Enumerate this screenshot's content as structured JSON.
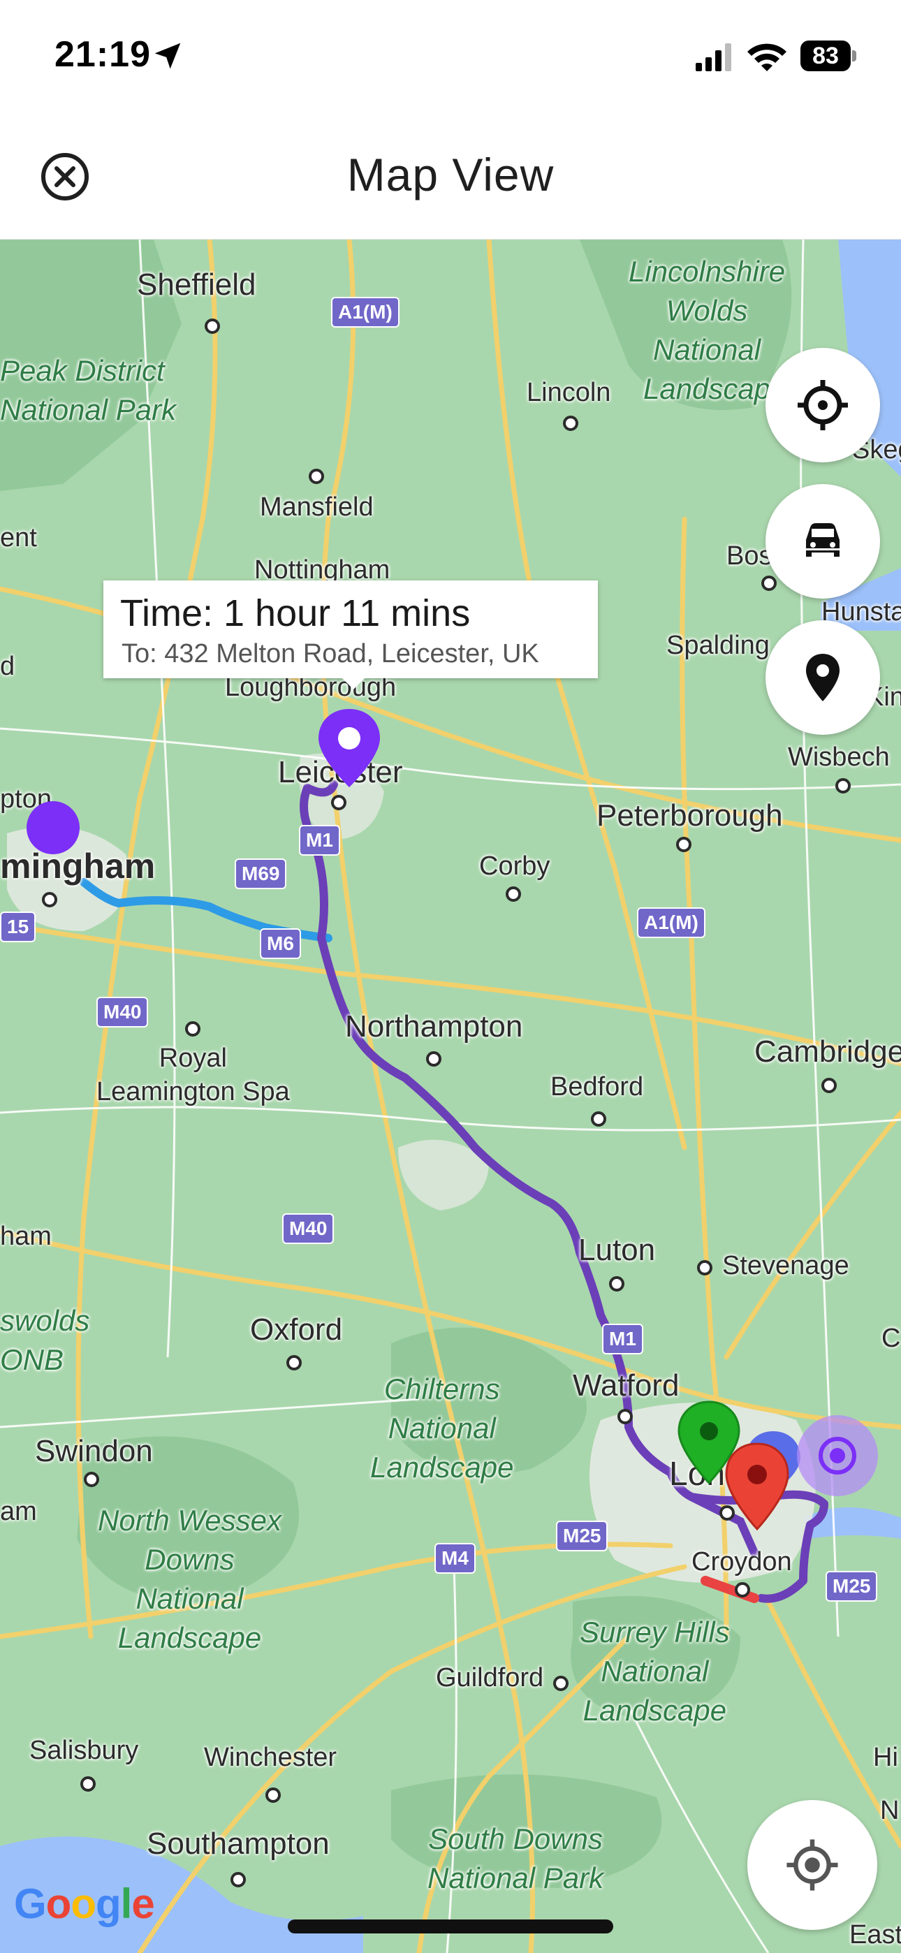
{
  "status_bar": {
    "time": "21:19",
    "battery": "83"
  },
  "header": {
    "title": "Map View"
  },
  "info_window": {
    "title": "Time: 1 hour 11 mins",
    "subtitle": "To: 432 Melton Road, Leicester, UK"
  },
  "map_labels": {
    "sheffield": "Sheffield",
    "peak": "Peak District\nNational Park",
    "lincolnshire": "Lincolnshire\nWolds\nNational\nLandscap",
    "lincoln": "Lincoln",
    "mansfield": "Mansfield",
    "nottingham": "Nottingham",
    "bos": "Bos",
    "hunsta": "Hunsta",
    "spalding": "Spalding",
    "loughborough": "Loughborough",
    "leicester": "Leicester",
    "wisbech": "Wisbech",
    "peterborough": "Peterborough",
    "birmingham": "mingham",
    "corby": "Corby",
    "northampton": "Northampton",
    "royal": "Royal\nLeamington Spa",
    "cambridge": "Cambridge",
    "bedford": "Bedford",
    "luton": "Luton",
    "stevenage": "Stevenage",
    "ham": "ham",
    "cotswolds": "swolds\nONB",
    "oxford": "Oxford",
    "chilterns": "Chilterns\nNational\nLandscape",
    "watford": "Watford",
    "swindon": "Swindon",
    "am": "am",
    "north_wessex": "North Wessex\nDowns\nNational\nLandscape",
    "london": "Lon",
    "croydon": "Croydon",
    "surrey": "Surrey Hills\nNational\nLandscape",
    "guildford": "Guildford",
    "salisbury": "Salisbury",
    "winchester": "Winchester",
    "southampton": "Southampton",
    "south_downs": "South Downs\nNational Park",
    "eastbo": "Eastbo",
    "ent": "ent",
    "d": "d",
    "pton": "pton",
    "skeg": "Skeg",
    "kin": "Kin",
    "c": "C",
    "hi": "Hi",
    "n": "N"
  },
  "road_shields": {
    "a1m_top": "A1(M)",
    "m1_a": "M1",
    "m69": "M69",
    "m6": "M6",
    "a1m_mid": "A1(M)",
    "m40_a": "M40",
    "m40_b": "M40",
    "m1_b": "M1",
    "m25_a": "M25",
    "m4": "M4",
    "m25_b": "M25",
    "m5": "15"
  },
  "google_logo": "Google",
  "icons": [
    "close-icon",
    "location-arrow-icon",
    "signal-icon",
    "wifi-icon",
    "battery-icon",
    "crosshair-icon",
    "car-icon",
    "pin-icon",
    "recenter-icon"
  ],
  "colors": {
    "route": "#6b3fb8",
    "route_alt": "#2e9be6",
    "marker_purple": "#7b2ff7",
    "land": "#a9d7ad",
    "water": "#9cc0f9"
  }
}
